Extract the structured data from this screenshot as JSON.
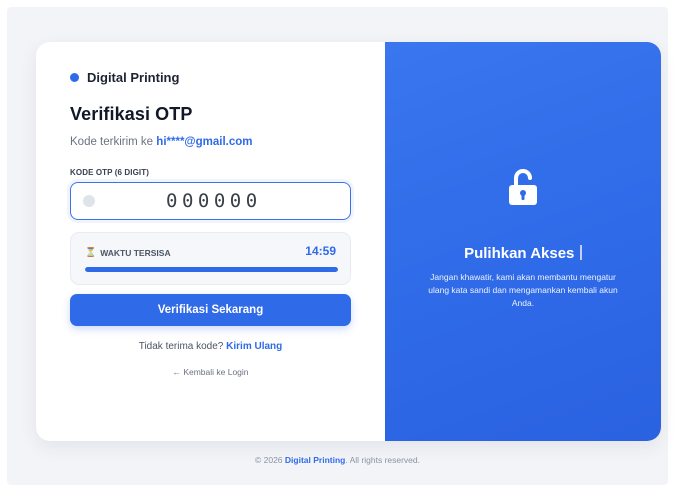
{
  "brand": {
    "name": "Digital Printing"
  },
  "form": {
    "title": "Verifikasi OTP",
    "sent_prefix": "Kode terkirim ke",
    "email": "hi****@gmail.com",
    "otp_label": "KODE OTP (6 DIGIT)",
    "otp_value": "000000"
  },
  "timer": {
    "label": "WAKTU TERSISA",
    "time": "14:59",
    "progress": 1.0
  },
  "submit_label": "Verifikasi Sekarang",
  "resend": {
    "prefix": "Tidak terima kode?",
    "link": "Kirim Ulang"
  },
  "back_label": "← Kembali ke Login",
  "panel": {
    "title": "Pulihkan Akses",
    "description": "Jangan khawatir, kami akan membantu mengatur ulang kata sandi dan mengamankan kembali akun Anda."
  },
  "footer": {
    "prefix": "© 2026",
    "brand": "Digital Printing",
    "suffix": ". All rights reserved."
  },
  "colors": {
    "accent": "#2f6ae8",
    "panel": "#3270ea"
  }
}
